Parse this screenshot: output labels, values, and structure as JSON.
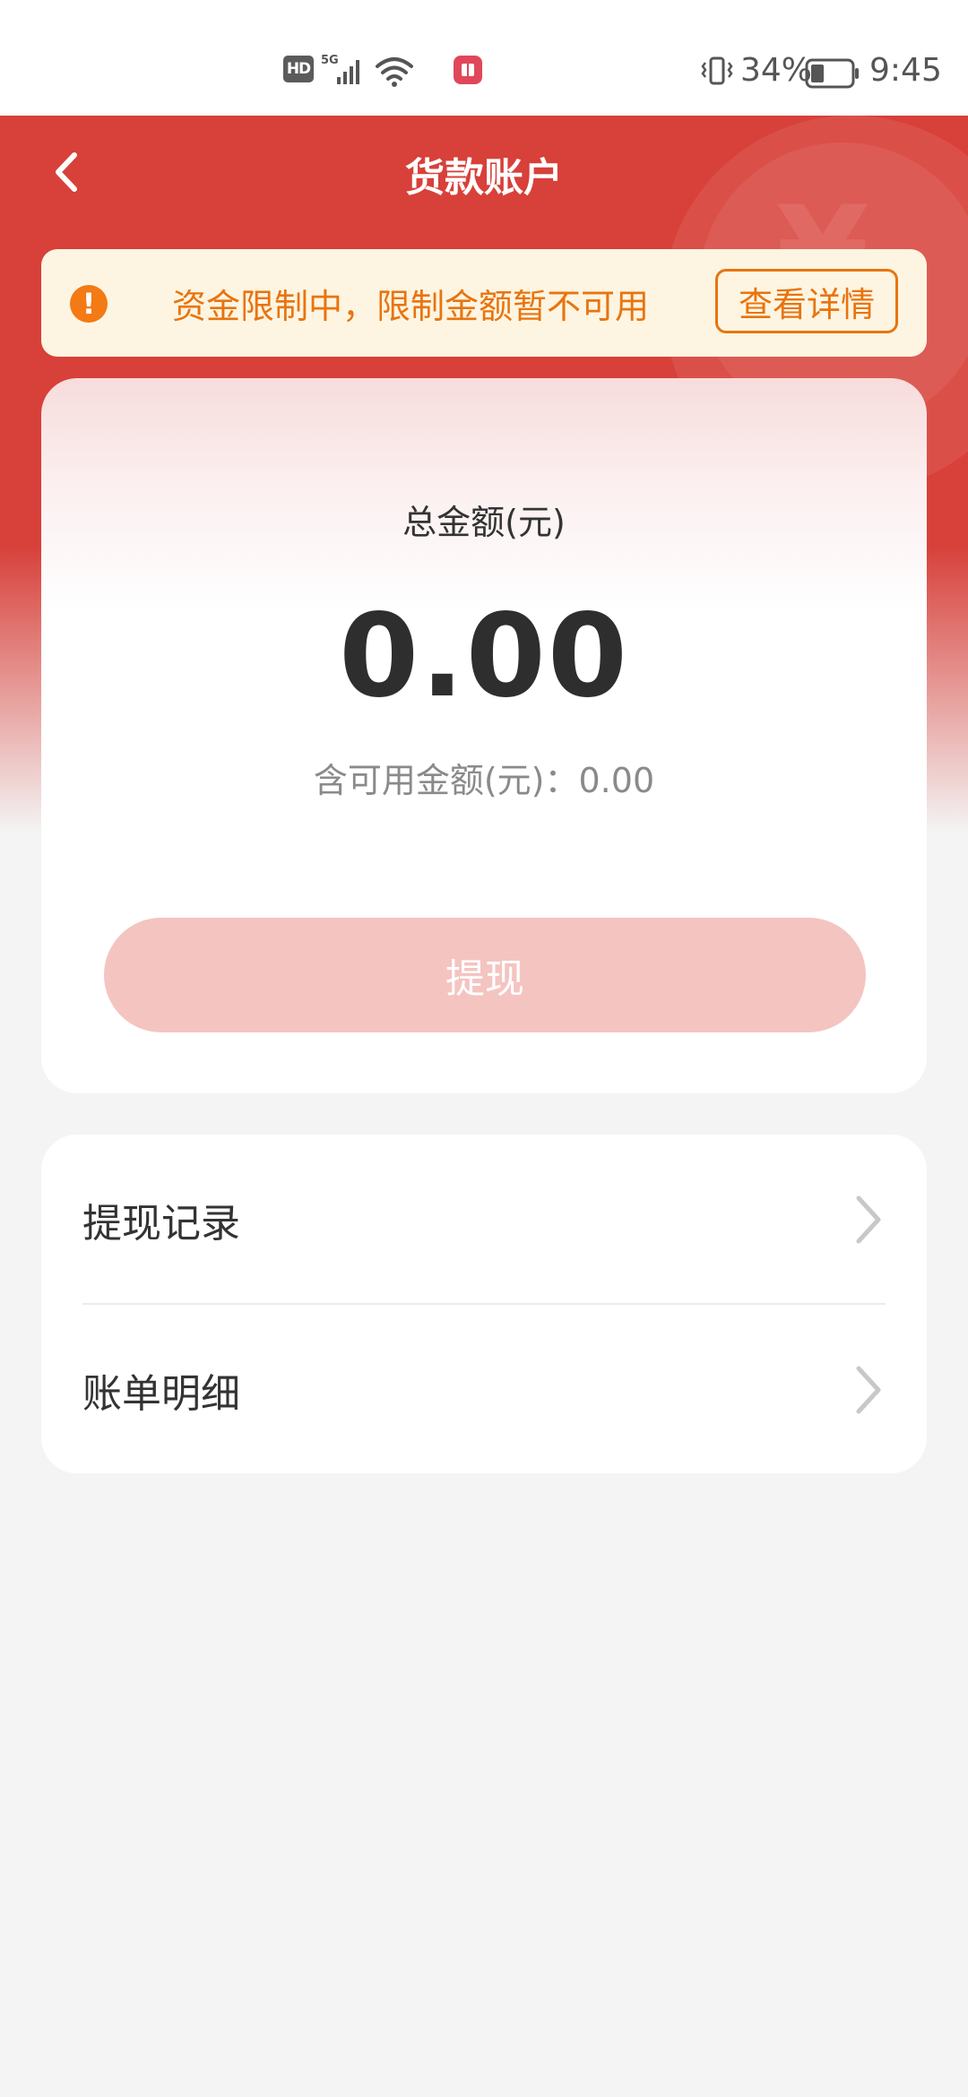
{
  "status_bar": {
    "hd_badge": "HD",
    "network": "5G",
    "battery_percent": "34%",
    "battery_level": 0.34,
    "time": "9:45"
  },
  "header": {
    "title": "货款账户",
    "back_icon": "chevron-left-icon"
  },
  "notice": {
    "icon": "exclamation-icon",
    "text": "资金限制中，限制金额暂不可用",
    "button_label": "查看详情"
  },
  "balance": {
    "total_label": "总金额(元)",
    "total_amount": "0.00",
    "available_text": "含可用金额(元)：0.00",
    "withdraw_label": "提现"
  },
  "menu": {
    "items": [
      {
        "label": "提现记录",
        "icon": "chevron-right-icon"
      },
      {
        "label": "账单明细",
        "icon": "chevron-right-icon"
      }
    ]
  },
  "colors": {
    "brand_red": "#d8403a",
    "notice_orange": "#e9740f",
    "notice_bg": "#fdf5e1",
    "withdraw_disabled": "#f4c4c1",
    "page_bg": "#f4f4f4"
  }
}
